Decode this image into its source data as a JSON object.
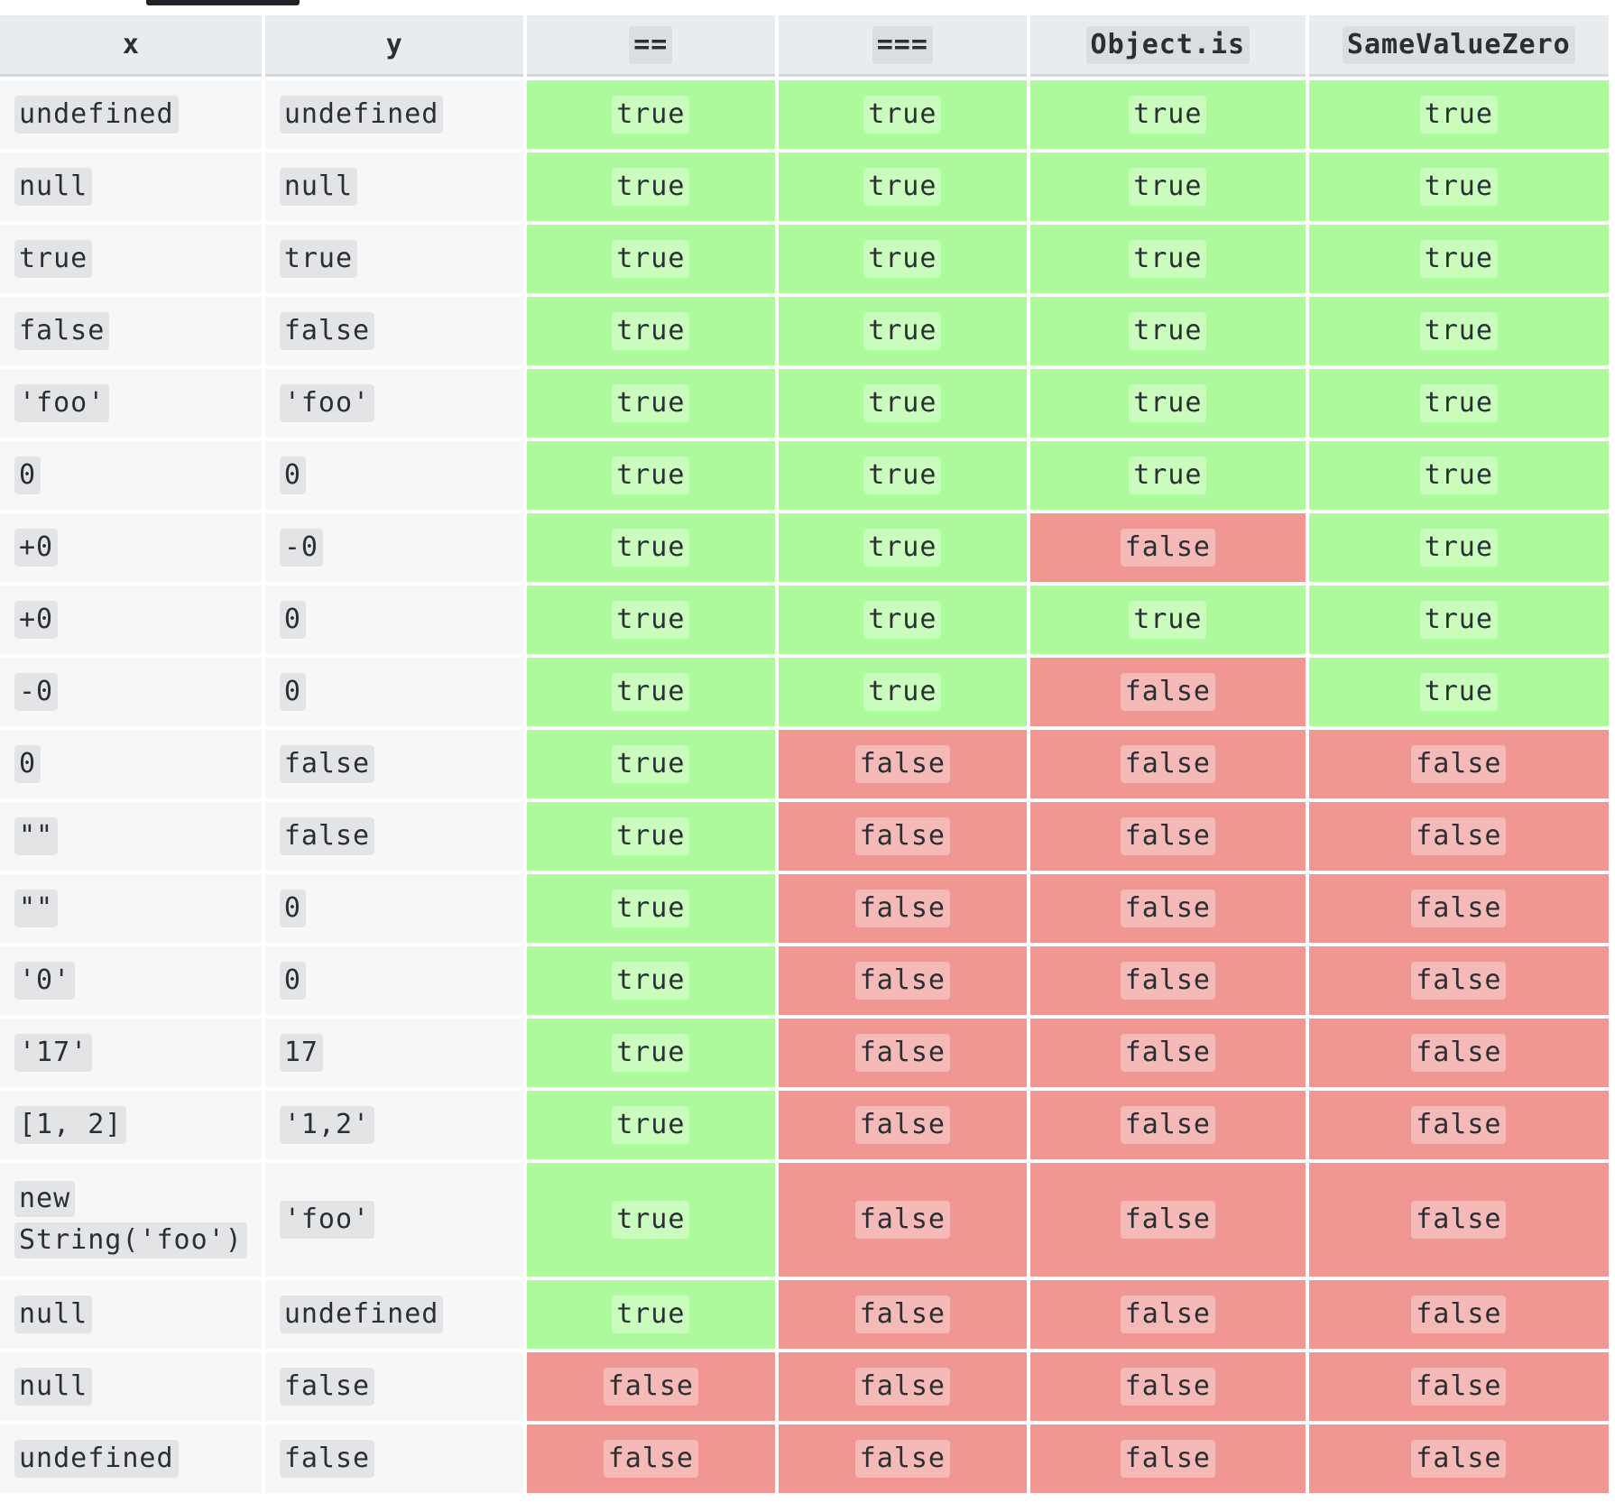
{
  "table": {
    "columns": [
      "x",
      "y",
      "==",
      "===",
      "Object.is",
      "SameValueZero"
    ],
    "rows": [
      {
        "x": "undefined",
        "y": "undefined",
        "r": [
          "true",
          "true",
          "true",
          "true"
        ]
      },
      {
        "x": "null",
        "y": "null",
        "r": [
          "true",
          "true",
          "true",
          "true"
        ]
      },
      {
        "x": "true",
        "y": "true",
        "r": [
          "true",
          "true",
          "true",
          "true"
        ]
      },
      {
        "x": "false",
        "y": "false",
        "r": [
          "true",
          "true",
          "true",
          "true"
        ]
      },
      {
        "x": "'foo'",
        "y": "'foo'",
        "r": [
          "true",
          "true",
          "true",
          "true"
        ]
      },
      {
        "x": "0",
        "y": "0",
        "r": [
          "true",
          "true",
          "true",
          "true"
        ]
      },
      {
        "x": "+0",
        "y": "-0",
        "r": [
          "true",
          "true",
          "false",
          "true"
        ]
      },
      {
        "x": "+0",
        "y": "0",
        "r": [
          "true",
          "true",
          "true",
          "true"
        ]
      },
      {
        "x": "-0",
        "y": "0",
        "r": [
          "true",
          "true",
          "false",
          "true"
        ]
      },
      {
        "x": "0",
        "y": "false",
        "r": [
          "true",
          "false",
          "false",
          "false"
        ]
      },
      {
        "x": "\"\"",
        "y": "false",
        "r": [
          "true",
          "false",
          "false",
          "false"
        ]
      },
      {
        "x": "\"\"",
        "y": "0",
        "r": [
          "true",
          "false",
          "false",
          "false"
        ]
      },
      {
        "x": "'0'",
        "y": "0",
        "r": [
          "true",
          "false",
          "false",
          "false"
        ]
      },
      {
        "x": "'17'",
        "y": "17",
        "r": [
          "true",
          "false",
          "false",
          "false"
        ]
      },
      {
        "x": "[1, 2]",
        "y": "'1,2'",
        "r": [
          "true",
          "false",
          "false",
          "false"
        ]
      },
      {
        "x_lines": [
          "new",
          "String('foo')"
        ],
        "y": "'foo'",
        "r": [
          "true",
          "false",
          "false",
          "false"
        ]
      },
      {
        "x": "null",
        "y": "undefined",
        "r": [
          "true",
          "false",
          "false",
          "false"
        ]
      },
      {
        "x": "null",
        "y": "false",
        "r": [
          "false",
          "false",
          "false",
          "false"
        ]
      },
      {
        "x": "undefined",
        "y": "false",
        "r": [
          "false",
          "false",
          "false",
          "false"
        ]
      }
    ]
  },
  "colors": {
    "true_cell": "#adfa9c",
    "false_cell": "#f09793",
    "operand_cell": "#f6f7f9",
    "header_cell": "#e9ecef"
  }
}
